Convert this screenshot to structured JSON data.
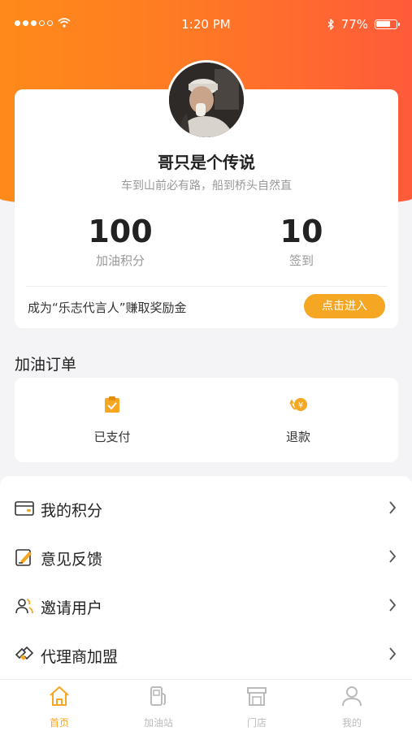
{
  "status_bar": {
    "time": "1:20 PM",
    "battery": "77%",
    "battery_level": 0.77,
    "signal_bars": 3
  },
  "profile": {
    "username": "哥只是个传说",
    "motto": "车到山前必有路，船到桥头自然直",
    "points_value": "100",
    "points_label": "加油积分",
    "checkin_value": "10",
    "checkin_label": "签到"
  },
  "promo": {
    "text": "成为“乐志代言人”赚取奖励金",
    "button": "点击进入"
  },
  "orders": {
    "title": "加油订单",
    "items": [
      {
        "label": "已支付",
        "icon": "clipboard-check-icon"
      },
      {
        "label": "退款",
        "icon": "refund-coin-icon"
      }
    ]
  },
  "menu": [
    {
      "label": "我的积分",
      "icon": "card-icon"
    },
    {
      "label": "意见反馈",
      "icon": "edit-note-icon"
    },
    {
      "label": "邀请用户",
      "icon": "users-icon"
    },
    {
      "label": "代理商加盟",
      "icon": "handshake-icon"
    }
  ],
  "tabs": [
    {
      "label": "首页",
      "icon": "home-icon",
      "active": true
    },
    {
      "label": "加油站",
      "icon": "gas-station-icon",
      "active": false
    },
    {
      "label": "门店",
      "icon": "store-icon",
      "active": false
    },
    {
      "label": "我的",
      "icon": "person-icon",
      "active": false
    }
  ],
  "colors": {
    "accent": "#f5a623",
    "hero_start": "#ff8a1a",
    "hero_end": "#ff5a3a"
  }
}
